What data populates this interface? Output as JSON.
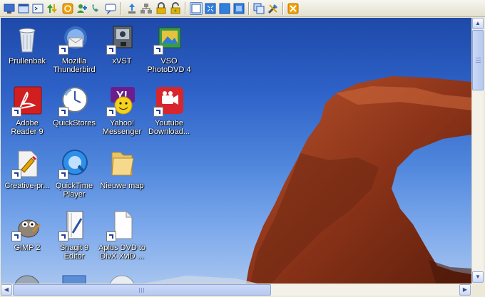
{
  "toolbar": {
    "buttons": [
      {
        "icon": "monitor-icon"
      },
      {
        "icon": "window-icon"
      },
      {
        "icon": "terminal-icon"
      },
      {
        "icon": "transfer-arrows-icon"
      },
      {
        "icon": "power-icon"
      },
      {
        "icon": "add-user-icon"
      },
      {
        "icon": "phone-icon"
      },
      {
        "icon": "chat-icon"
      },
      {
        "icon": "upload-icon"
      },
      {
        "icon": "network-icon"
      },
      {
        "icon": "lock-icon"
      },
      {
        "icon": "unlock-icon"
      },
      {
        "icon": "view-normal-icon"
      },
      {
        "icon": "fit-window-icon"
      },
      {
        "icon": "fullscreen-icon"
      },
      {
        "icon": "scale-icon"
      },
      {
        "icon": "copy-screen-icon"
      },
      {
        "icon": "tools-icon"
      },
      {
        "icon": "disconnect-icon"
      }
    ]
  },
  "desktop": {
    "icons": [
      {
        "label": "Prullenbak",
        "icon": "recycle-bin-icon",
        "shortcut": false
      },
      {
        "label": "Mozilla\nThunderbird",
        "icon": "thunderbird-icon",
        "shortcut": true
      },
      {
        "label": "xVST",
        "icon": "xvst-icon",
        "shortcut": true
      },
      {
        "label": "VSO\nPhotoDVD 4",
        "icon": "photodvd-icon",
        "shortcut": true
      },
      {
        "label": "Adobe\nReader 9",
        "icon": "adobe-reader-icon",
        "shortcut": true
      },
      {
        "label": "QuickStores",
        "icon": "quickstores-icon",
        "shortcut": true
      },
      {
        "label": "Yahoo!\nMessenger",
        "icon": "yahoo-messenger-icon",
        "shortcut": true
      },
      {
        "label": "Youtube\nDownload...",
        "icon": "youtube-downloader-icon",
        "shortcut": true
      },
      {
        "label": "Creative-pr...",
        "icon": "creative-icon",
        "shortcut": true
      },
      {
        "label": "QuickTime\nPlayer",
        "icon": "quicktime-icon",
        "shortcut": true
      },
      {
        "label": "Nieuwe map",
        "icon": "folder-icon",
        "shortcut": false
      },
      {
        "label": "GIMP 2",
        "icon": "gimp-icon",
        "shortcut": true
      },
      {
        "label": "Snagit 9\nEditor",
        "icon": "snagit-icon",
        "shortcut": true
      },
      {
        "label": "Aplus DVD to\nDivX XviD ...",
        "icon": "file-icon",
        "shortcut": true
      }
    ]
  },
  "scrollbars": {
    "vertical_position": 0.0,
    "horizontal_position": 0.0
  }
}
